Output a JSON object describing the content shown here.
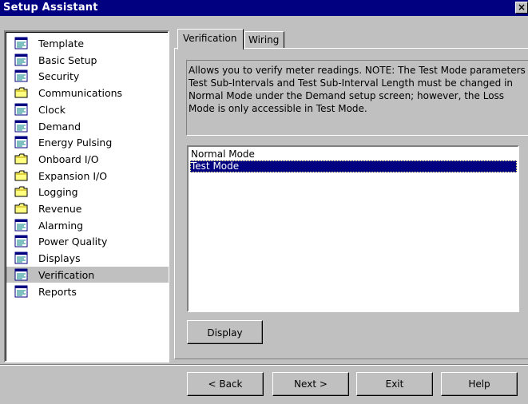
{
  "window": {
    "title": "Setup Assistant",
    "close_glyph": "×"
  },
  "tree": {
    "items": [
      {
        "label": "Template",
        "icon": "document-icon",
        "selected": false
      },
      {
        "label": "Basic Setup",
        "icon": "document-icon",
        "selected": false
      },
      {
        "label": "Security",
        "icon": "document-icon",
        "selected": false
      },
      {
        "label": "Communications",
        "icon": "folder-icon",
        "selected": false
      },
      {
        "label": "Clock",
        "icon": "document-icon",
        "selected": false
      },
      {
        "label": "Demand",
        "icon": "document-icon",
        "selected": false
      },
      {
        "label": "Energy Pulsing",
        "icon": "document-icon",
        "selected": false
      },
      {
        "label": "Onboard I/O",
        "icon": "folder-icon",
        "selected": false
      },
      {
        "label": "Expansion I/O",
        "icon": "folder-icon",
        "selected": false
      },
      {
        "label": "Logging",
        "icon": "folder-icon",
        "selected": false
      },
      {
        "label": "Revenue",
        "icon": "folder-icon",
        "selected": false
      },
      {
        "label": "Alarming",
        "icon": "document-icon",
        "selected": false
      },
      {
        "label": "Power Quality",
        "icon": "document-icon",
        "selected": false
      },
      {
        "label": "Displays",
        "icon": "document-icon",
        "selected": false
      },
      {
        "label": "Verification",
        "icon": "document-icon",
        "selected": true
      },
      {
        "label": "Reports",
        "icon": "document-icon",
        "selected": false
      }
    ]
  },
  "tabs": [
    {
      "label": "Verification",
      "active": true
    },
    {
      "label": "Wiring",
      "active": false
    }
  ],
  "description": "Allows you to verify meter readings. NOTE: The Test Mode parameters Test Sub-Intervals and Test Sub-Interval Length must be changed in Normal Mode under the Demand setup screen; however, the Loss Mode is only accessible in Test Mode.",
  "mode_list": {
    "items": [
      {
        "label": "Normal Mode",
        "selected": false
      },
      {
        "label": "Test Mode",
        "selected": true
      }
    ]
  },
  "buttons": {
    "display": "Display",
    "back": "< Back",
    "next": "Next >",
    "exit": "Exit",
    "help": "Help"
  },
  "colors": {
    "title_bar": "#000080",
    "selection": "#000080",
    "face": "#c0c0c0"
  }
}
